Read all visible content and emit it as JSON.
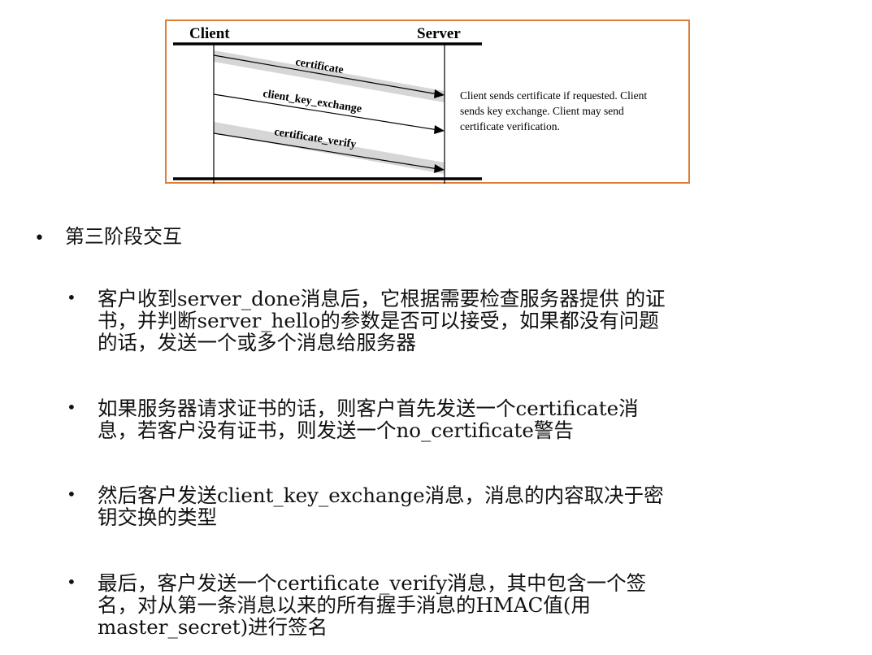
{
  "diagram": {
    "client_label": "Client",
    "server_label": "Server",
    "messages": [
      "certificate",
      "client_key_exchange",
      "certificate_verify"
    ],
    "note_lines": [
      "Client sends certificate if requested. Client",
      "sends key exchange. Client may send",
      "certificate verification."
    ],
    "border_color": "#e07b35"
  },
  "heading": {
    "bullet": "•",
    "text": "第三阶段交互"
  },
  "items": [
    {
      "bullet": "•",
      "lines": [
        "客户收到server_done消息后，它根据需要检查服务器提供 的证",
        "书，并判断server_hello的参数是否可以接受，如果都没有问题",
        "的话，发送一个或多个消息给服务器"
      ]
    },
    {
      "bullet": "•",
      "lines": [
        "如果服务器请求证书的话，则客户首先发送一个certificate消",
        "息，若客户没有证书，则发送一个no_certificate警告"
      ]
    },
    {
      "bullet": "•",
      "lines": [
        "然后客户发送client_key_exchange消息，消息的内容取决于密",
        "钥交换的类型"
      ]
    },
    {
      "bullet": "•",
      "lines": [
        "最后，客户发送一个certificate_verify消息，其中包含一个签",
        "名，对从第一条消息以来的所有握手消息的HMAC值(用",
        "master_secret)进行签名"
      ]
    }
  ]
}
